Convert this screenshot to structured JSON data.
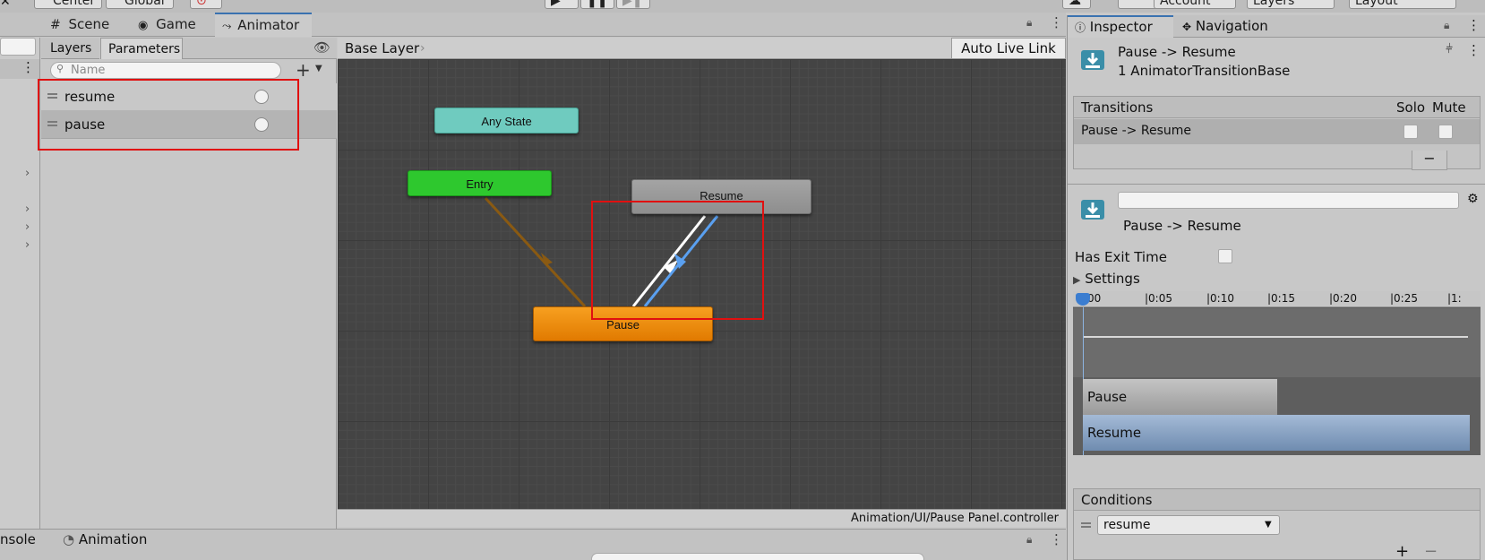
{
  "toolbar": {
    "center_label": "Center",
    "global_label": "Global",
    "account_label": "Account",
    "layers_label": "Layers",
    "layout_label": "Layout"
  },
  "tabs": {
    "scene": "Scene",
    "game": "Game",
    "animator": "Animator"
  },
  "animator": {
    "subtabs": {
      "layers": "Layers",
      "parameters": "Parameters"
    },
    "search_placeholder": "Name",
    "parameters": [
      {
        "name": "resume"
      },
      {
        "name": "pause"
      }
    ],
    "breadcrumb": "Base Layer",
    "auto_live_link": "Auto Live Link",
    "states": {
      "any_state": "Any State",
      "entry": "Entry",
      "resume": "Resume",
      "pause": "Pause"
    },
    "controller_path": "Animation/UI/Pause Panel.controller"
  },
  "bottom_tabs": {
    "console": "nsole",
    "animation": "Animation"
  },
  "inspector": {
    "tabs": {
      "inspector": "Inspector",
      "navigation": "Navigation"
    },
    "header_title": "Pause -> Resume",
    "header_subtitle": "1 AnimatorTransitionBase",
    "transitions": {
      "header": "Transitions",
      "solo": "Solo",
      "mute": "Mute",
      "row": "Pause -> Resume"
    },
    "transition_name_value": "",
    "transition_label": "Pause -> Resume",
    "has_exit_time": "Has Exit Time",
    "settings": "Settings",
    "timeline": {
      "ticks": [
        "0:00",
        "0:05",
        "0:10",
        "0:15",
        "0:20",
        "0:25",
        "1:"
      ],
      "tick_visible": [
        ":00",
        "|0:05",
        "|0:10",
        "|0:15",
        "|0:20",
        "|0:25",
        "|1:"
      ],
      "source_clip": "Pause",
      "dest_clip": "Resume"
    },
    "conditions": {
      "header": "Conditions",
      "param": "resume"
    }
  },
  "colors": {
    "any_state": "#6fcbbf",
    "entry": "#2ec82e",
    "resume": "#9a9a9a",
    "pause": "#f08c10",
    "transition_selected": "#5aa0f0",
    "highlight": "#e01010"
  }
}
